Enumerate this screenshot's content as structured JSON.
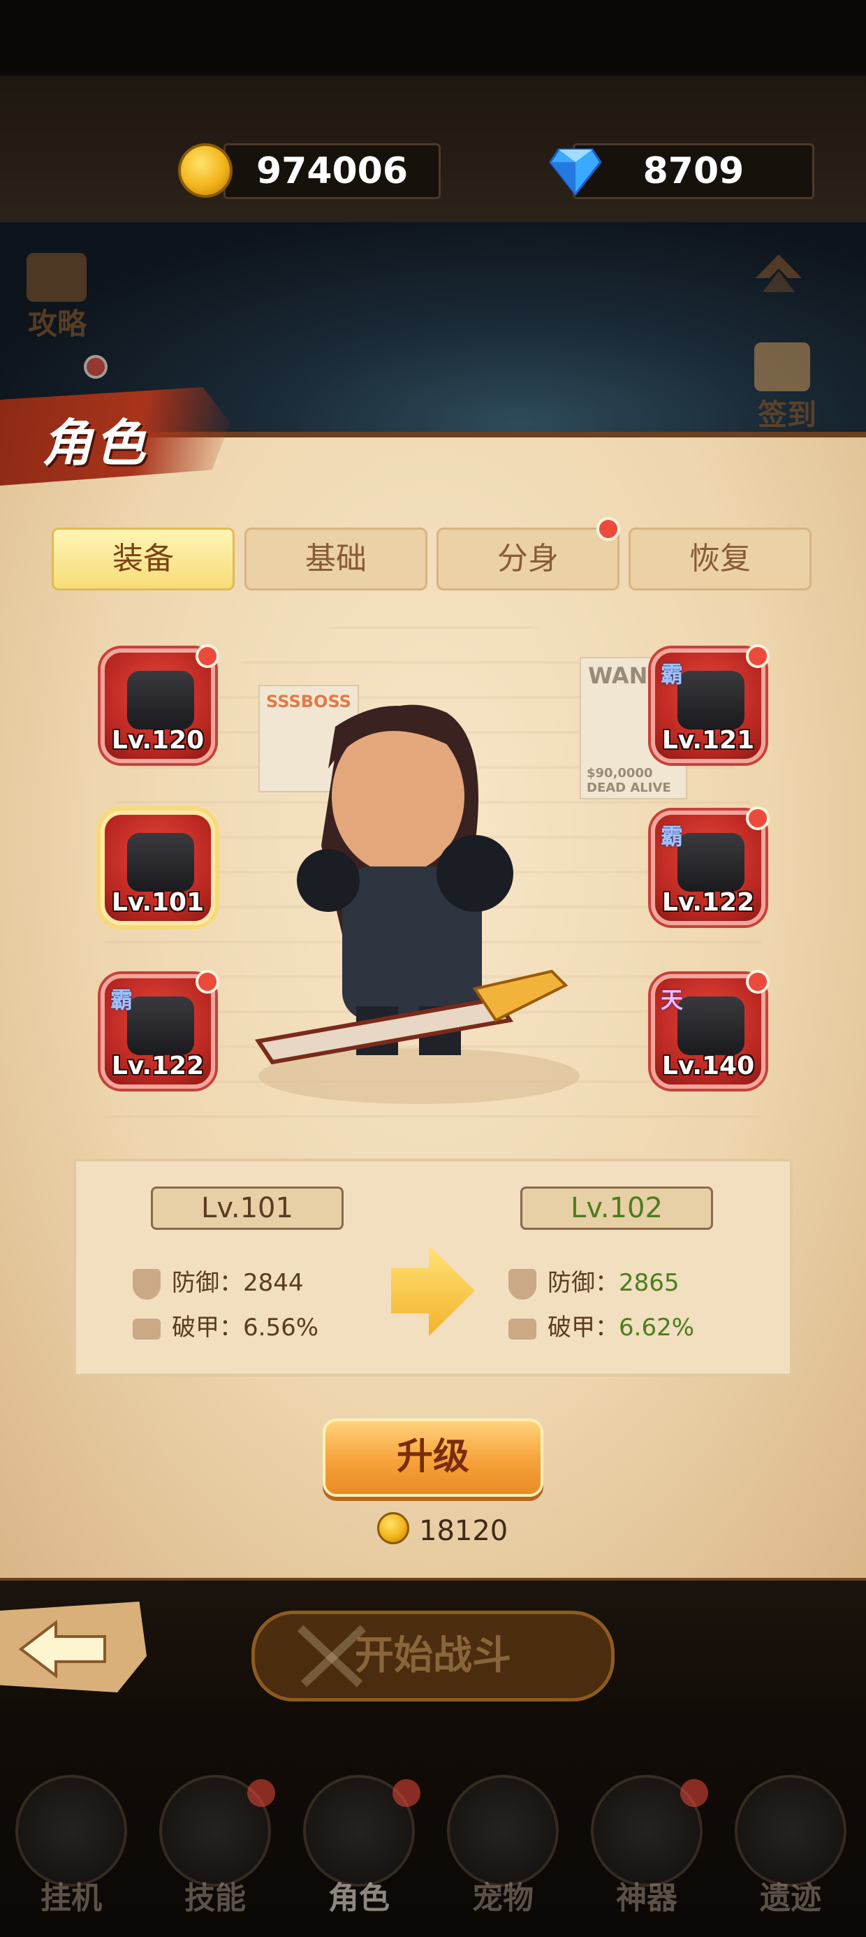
{
  "currency": {
    "gold": "974006",
    "gems": "8709"
  },
  "top_icons": {
    "guide_label": "攻略",
    "signin_label": "签到"
  },
  "title": "角色",
  "tabs": [
    {
      "label": "装备",
      "active": true
    },
    {
      "label": "基础",
      "active": false
    },
    {
      "label": "分身",
      "active": false,
      "has_dot": true
    },
    {
      "label": "恢复",
      "active": false
    }
  ],
  "poster": {
    "left": "SSSBOSS",
    "right_top": "WAN",
    "right_bottom": "$90,0000 DEAD ALIVE"
  },
  "equipment": {
    "left": [
      {
        "level": "Lv.120",
        "item_icon": "weapon-icon",
        "selected": false,
        "tag": ""
      },
      {
        "level": "Lv.101",
        "item_icon": "armor-icon",
        "selected": true,
        "tag": ""
      },
      {
        "level": "Lv.122",
        "item_icon": "gauntlet-icon",
        "selected": false,
        "tag": "霸"
      }
    ],
    "right": [
      {
        "level": "Lv.121",
        "item_icon": "helmet-icon",
        "selected": false,
        "tag": "霸"
      },
      {
        "level": "Lv.122",
        "item_icon": "necklace-icon",
        "selected": false,
        "tag": "霸"
      },
      {
        "level": "Lv.140",
        "item_icon": "ring-icon",
        "selected": false,
        "tag": "天"
      }
    ]
  },
  "stats": {
    "current_level": "Lv.101",
    "next_level": "Lv.102",
    "defense_label": "防御：",
    "armor_pen_label": "破甲：",
    "current_defense": "2844",
    "current_armor_pen": "6.56%",
    "next_defense": "2865",
    "next_armor_pen": "6.62%"
  },
  "upgrade": {
    "label": "升级",
    "cost": "18120"
  },
  "start_battle": "开始战斗",
  "bottom_nav": [
    {
      "label": "挂机",
      "dot": false
    },
    {
      "label": "技能",
      "dot": true
    },
    {
      "label": "角色",
      "dot": true,
      "active": true
    },
    {
      "label": "宠物",
      "dot": false
    },
    {
      "label": "神器",
      "dot": true
    },
    {
      "label": "遗迹",
      "dot": false
    }
  ],
  "colors": {
    "accent_red": "#ec4b3b",
    "gold": "#f2b41b",
    "green_value": "#4d7d1c",
    "parchment": "#eed6ae"
  }
}
